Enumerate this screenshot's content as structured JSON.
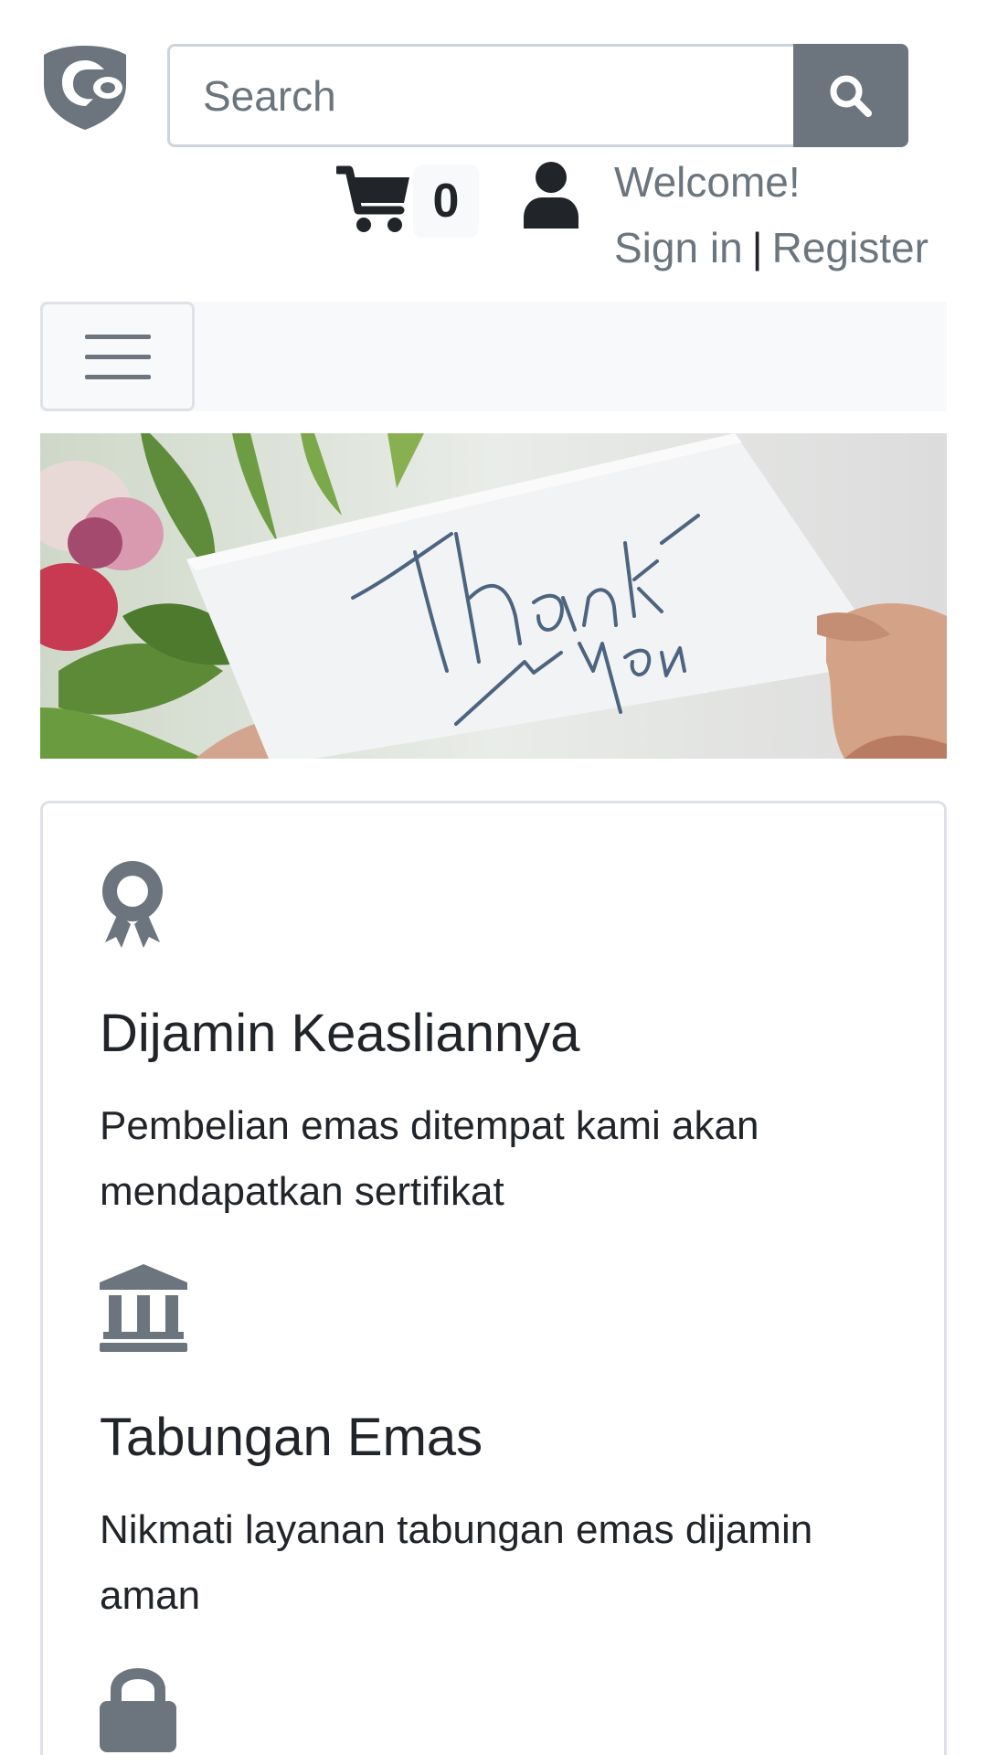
{
  "header": {
    "logo_icon": "shield-eye-logo",
    "search": {
      "placeholder": "Search",
      "button_icon": "search-icon"
    },
    "cart": {
      "icon": "shopping-cart-icon",
      "count": "0"
    },
    "user": {
      "icon": "user-icon",
      "welcome": "Welcome!",
      "sign_in": "Sign in",
      "separator": "|",
      "register": "Register"
    }
  },
  "navbar": {
    "toggler_icon": "hamburger-menu-icon"
  },
  "hero": {
    "card_text": "Thank you"
  },
  "features": [
    {
      "icon": "award-ribbon-icon",
      "title": "Dijamin Keasliannya",
      "text": "Pembelian emas ditempat kami akan mendapatkan sertifikat"
    },
    {
      "icon": "bank-building-icon",
      "title": "Tabungan Emas",
      "text": "Nikmati layanan tabungan emas dijamin aman"
    },
    {
      "icon": "lock-icon"
    }
  ],
  "colors": {
    "icon_gray": "#6c757d",
    "border": "#dee2e6",
    "navbar_bg": "#f8f9fa",
    "text": "#212529"
  }
}
